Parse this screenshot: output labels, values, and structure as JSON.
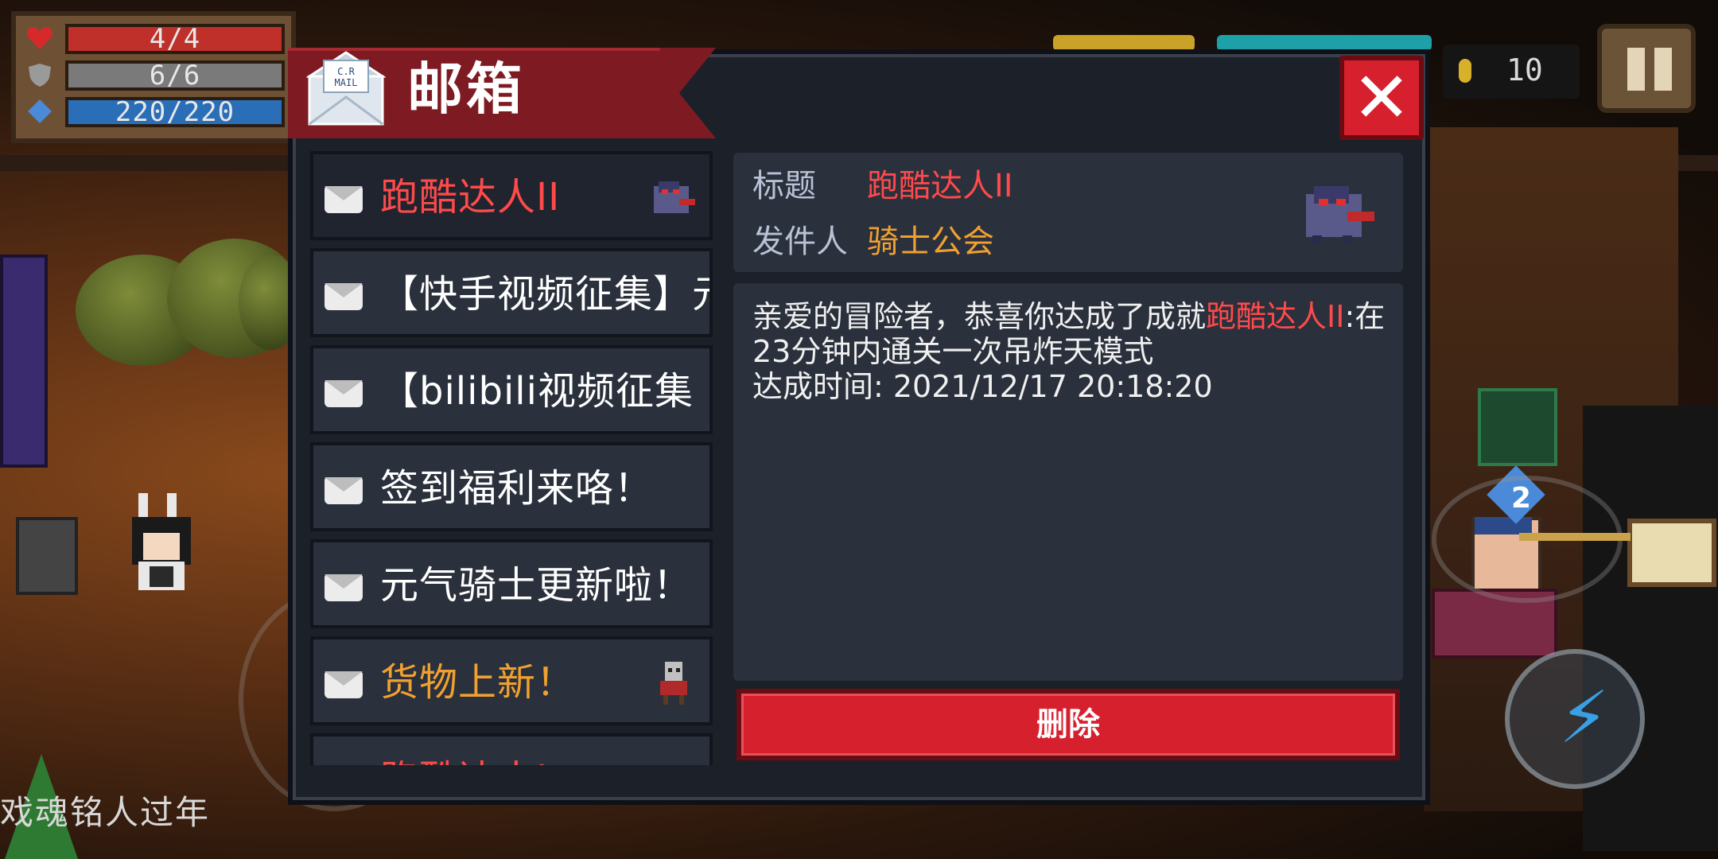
{
  "colors": {
    "accent_red": "#d7202e",
    "title_red": "#ff4a4a",
    "sender_orange": "#f0a030",
    "panel_bg": "#1b2029",
    "header_red": "#7e1b22"
  },
  "hud": {
    "hp": "4/4",
    "armor": "6/6",
    "energy": "220/220",
    "coins": "10",
    "hp_icon": "heart-icon",
    "armor_icon": "shield-icon",
    "energy_icon": "diamond-icon",
    "coin_icon": "coin-icon",
    "pause_icon": "pause-icon",
    "skill_icon": "lightning-icon"
  },
  "scene": {
    "bottom_text": "戏魂铭人过年"
  },
  "mailbox": {
    "title": "邮箱",
    "icon": "mail-envelope-icon",
    "close_icon": "close-icon",
    "items": [
      {
        "title": "跑酷达人II",
        "color": "#ff4a4a",
        "selected": true,
        "thumb": "creature-icon"
      },
      {
        "title": "【快手视频征集】元",
        "color": "#ffffff",
        "selected": false,
        "thumb": ""
      },
      {
        "title": "【bilibili视频征集",
        "color": "#ffffff",
        "selected": false,
        "thumb": ""
      },
      {
        "title": "签到福利来咯！",
        "color": "#ffffff",
        "selected": false,
        "thumb": ""
      },
      {
        "title": "元气骑士更新啦！",
        "color": "#ffffff",
        "selected": false,
        "thumb": ""
      },
      {
        "title": "货物上新！",
        "color": "#f0a030",
        "selected": false,
        "thumb": "merchant-icon"
      },
      {
        "title": "跑酷达人I",
        "color": "#ff4a4a",
        "selected": false,
        "thumb": ""
      }
    ],
    "detail": {
      "title_label": "标题",
      "title_value": "跑酷达人II",
      "sender_label": "发件人",
      "sender_value": "骑士公会",
      "thumb": "creature-icon",
      "body_prefix": "亲爱的冒险者，恭喜你达成了成就",
      "body_highlight": "跑酷达人II",
      "body_suffix": ":在23分钟内通关一次吊炸天模式",
      "time_line": "达成时间: 2021/12/17 20:18:20"
    },
    "delete_label": "删除"
  }
}
